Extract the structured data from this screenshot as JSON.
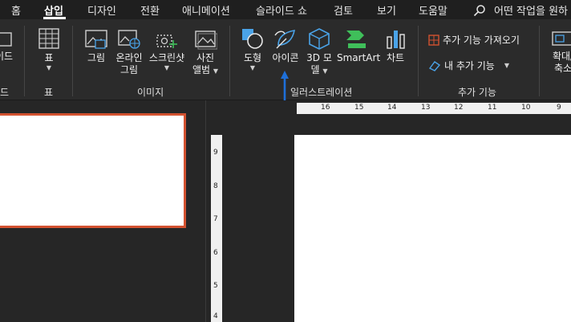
{
  "tabs": [
    {
      "label": "홈",
      "active": false
    },
    {
      "label": "삽입",
      "active": true
    },
    {
      "label": "디자인",
      "active": false
    },
    {
      "label": "전환",
      "active": false
    },
    {
      "label": "애니메이션",
      "active": false
    },
    {
      "label": "슬라이드 쇼",
      "active": false
    },
    {
      "label": "검토",
      "active": false
    },
    {
      "label": "보기",
      "active": false
    },
    {
      "label": "도움말",
      "active": false
    }
  ],
  "search": {
    "text": "어떤 작업을 원하"
  },
  "ribbon": {
    "partial_left": {
      "label": "이드",
      "group": "드"
    },
    "table": {
      "label": "표",
      "group": "표"
    },
    "images": {
      "group": "이미지",
      "picture": "그림",
      "online_picture_line1": "온라인",
      "online_picture_line2": "그림",
      "screenshot": "스크린샷",
      "album_line1": "사진",
      "album_line2": "앨범"
    },
    "illustrations": {
      "group": "일러스트레이션",
      "shapes": "도형",
      "icons": "아이콘",
      "model3d_line1": "3D 모",
      "model3d_line2": "델",
      "smartart": "SmartArt",
      "chart": "차트"
    },
    "addins": {
      "group": "추가 기능",
      "get_addins": "추가 기능 가져오기",
      "my_addins": "내 추가 기능"
    },
    "zoom": {
      "line1": "확대/",
      "line2": "축소"
    }
  },
  "ruler": {
    "horizontal": [
      "16",
      "15",
      "14",
      "13",
      "12",
      "11",
      "10",
      "9"
    ],
    "vertical": [
      "9",
      "8",
      "7",
      "6",
      "5",
      "4"
    ]
  },
  "colors": {
    "accent": "#d35230",
    "arrow": "#1e6fd9"
  }
}
